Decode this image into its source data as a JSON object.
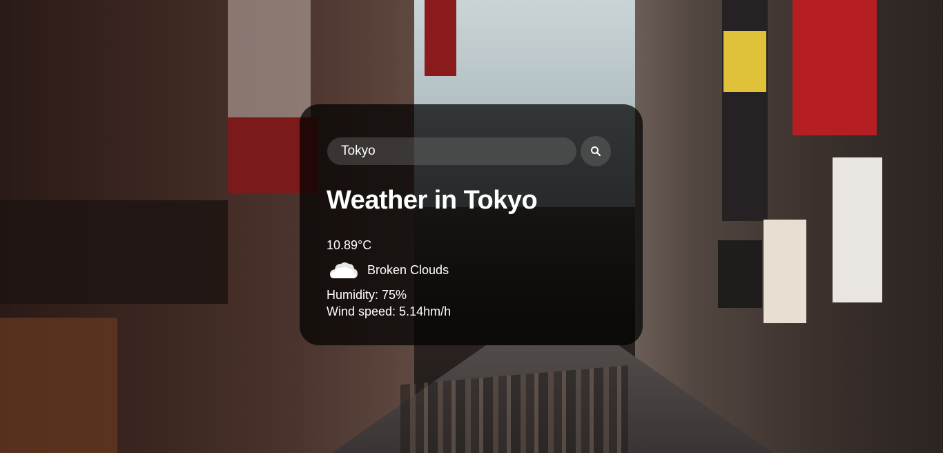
{
  "search": {
    "value": "Tokyo",
    "button_icon": "search-icon"
  },
  "weather": {
    "title": "Weather in Tokyo",
    "temperature": "10.89°C",
    "condition_icon": "cloud-icon",
    "condition": "Broken Clouds",
    "humidity": "Humidity: 75%",
    "wind": "Wind speed: 5.14hm/h"
  },
  "colors": {
    "card_background": "#000000",
    "text": "#ffffff",
    "input_background": "#7c7c7c"
  }
}
